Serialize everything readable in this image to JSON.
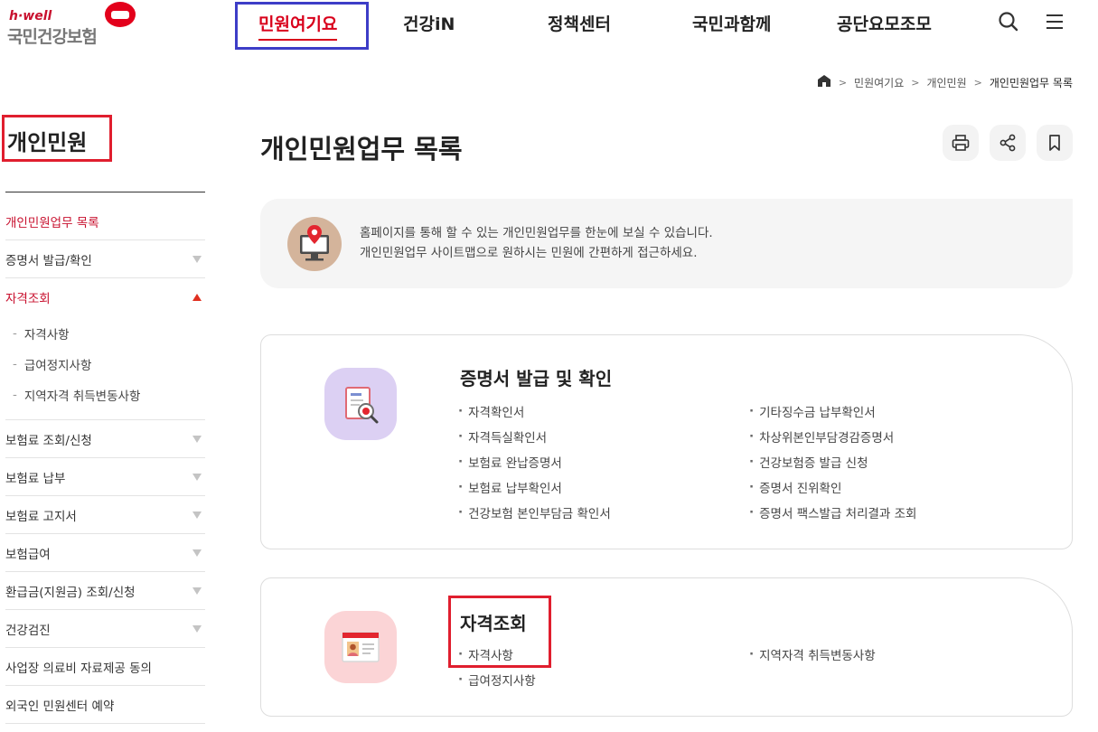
{
  "header": {
    "logo_small": "h·well",
    "logo_main": "국민건강보험",
    "nav": [
      "민원여기요",
      "건강iN",
      "정책센터",
      "국민과함께",
      "공단요모조모"
    ],
    "icons": [
      "search-icon",
      "menu-icon"
    ]
  },
  "breadcrumb": {
    "home_icon": "home-icon",
    "items": [
      "민원여기요",
      "개인민원",
      "개인민원업무 목록"
    ]
  },
  "sidebar": {
    "title": "개인민원",
    "items": [
      {
        "label": "개인민원업무 목록"
      },
      {
        "label": "증명서 발급/확인"
      },
      {
        "label": "자격조회"
      },
      {
        "label": "보험료 조회/신청"
      },
      {
        "label": "보험료 납부"
      },
      {
        "label": "보험료 고지서"
      },
      {
        "label": "보험급여"
      },
      {
        "label": "환급금(지원금) 조회/신청"
      },
      {
        "label": "건강검진"
      },
      {
        "label": "사업장 의료비 자료제공 동의"
      },
      {
        "label": "외국인 민원센터 예약"
      }
    ],
    "sub_items": [
      "자격사항",
      "급여정지사항",
      "지역자격 취득변동사항"
    ]
  },
  "main": {
    "title": "개인민원업무 목록",
    "tools": [
      "print-icon",
      "share-icon",
      "bookmark-icon"
    ],
    "intro_lines": [
      "홈페이지를 통해 할 수 있는 개인민원업무를 한눈에 보실 수 있습니다.",
      "개인민원업무 사이트맵으로 원하시는 민원에 간편하게 접근하세요."
    ],
    "sections": [
      {
        "title": "증명서 발급 및 확인",
        "links": [
          "자격확인서",
          "기타징수금 납부확인서",
          "자격득실확인서",
          "차상위본인부담경감증명서",
          "보험료 완납증명서",
          "건강보험증 발급 신청",
          "보험료 납부확인서",
          "증명서 진위확인",
          "건강보험 본인부담금 확인서",
          "증명서 팩스발급 처리결과 조회"
        ]
      },
      {
        "title": "자격조회",
        "links": [
          "자격사항",
          "지역자격 취득변동사항",
          "급여정지사항"
        ]
      }
    ]
  },
  "colors": {
    "brand_red": "#d9001b",
    "annotation_blue": "#3d3dc7",
    "annotation_red": "#e01e2e"
  }
}
